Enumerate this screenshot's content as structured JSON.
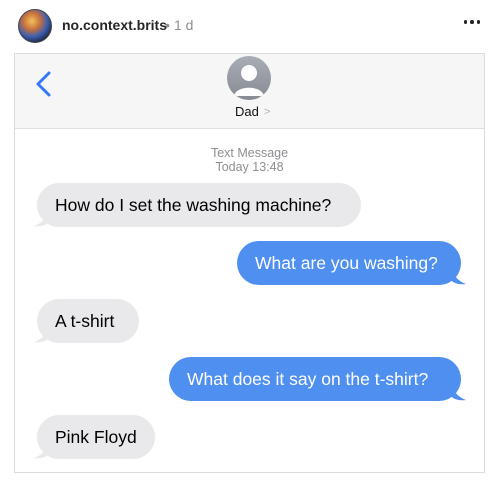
{
  "post": {
    "username": "no.context.brits",
    "separator": "•",
    "time": "1 d"
  },
  "conversation": {
    "contact_name": "Dad",
    "contact_chevron": ">",
    "meta_type": "Text Message",
    "meta_time": "Today 13:48",
    "messages": [
      {
        "direction": "incoming",
        "text": "How do I set the washing machine?"
      },
      {
        "direction": "outgoing",
        "text": "What are you washing?"
      },
      {
        "direction": "incoming",
        "text": "A t-shirt"
      },
      {
        "direction": "outgoing",
        "text": "What does it say on the t-shirt?"
      },
      {
        "direction": "incoming",
        "text": "Pink Floyd"
      }
    ]
  },
  "colors": {
    "incoming_bubble": "#e9e9eb",
    "outgoing_bubble": "#4e8ff0",
    "ios_accent": "#3478f6"
  }
}
